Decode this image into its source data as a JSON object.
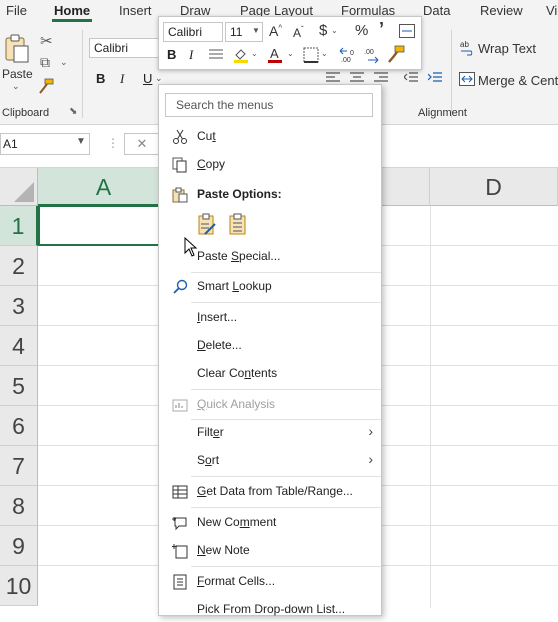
{
  "ribbon": {
    "tabs": [
      {
        "label": "File"
      },
      {
        "label": "Home"
      },
      {
        "label": "Insert"
      },
      {
        "label": "Draw"
      },
      {
        "label": "Page Layout"
      },
      {
        "label": "Formulas"
      },
      {
        "label": "Data"
      },
      {
        "label": "Review"
      },
      {
        "label": "View"
      }
    ],
    "active_tab": "Home",
    "paste_label": "Paste",
    "font_name": "Calibri",
    "clipboard_label": "Clipboard",
    "alignment_label": "Alignment",
    "wrap_text_label": "Wrap Text",
    "merge_label": "Merge & Center",
    "accent_color": "#217346"
  },
  "mini_toolbar": {
    "font": "Calibri",
    "size": "11",
    "currency_symbol": "$",
    "percent_symbol": "%",
    "comma_symbol": "’",
    "fill_color": "#FFD700",
    "font_color": "#C00000"
  },
  "formula_bar": {
    "name_box": "A1",
    "cancel_symbol": "✕"
  },
  "sheet": {
    "columns": [
      "A",
      "D"
    ],
    "rows": [
      "1",
      "2",
      "3",
      "4",
      "5",
      "6",
      "7",
      "8",
      "9",
      "10"
    ],
    "selected_cell": "A1"
  },
  "context_menu": {
    "search_placeholder": "Search the menus",
    "items": {
      "cut": {
        "pre": "Cu",
        "u": "t",
        "post": ""
      },
      "copy": {
        "pre": "",
        "u": "C",
        "post": "opy"
      },
      "paste_options": "Paste Options:",
      "paste_special": {
        "pre": "Paste ",
        "u": "S",
        "post": "pecial..."
      },
      "smart_lookup": {
        "pre": "Smart ",
        "u": "L",
        "post": "ookup"
      },
      "insert": {
        "pre": "",
        "u": "I",
        "post": "nsert..."
      },
      "delete": {
        "pre": "",
        "u": "D",
        "post": "elete..."
      },
      "clear_contents": {
        "pre": "Clear Co",
        "u": "n",
        "post": "tents"
      },
      "quick_analysis": {
        "pre": "",
        "u": "Q",
        "post": "uick Analysis"
      },
      "filter": {
        "pre": "Filt",
        "u": "e",
        "post": "r"
      },
      "sort": {
        "pre": "S",
        "u": "o",
        "post": "rt"
      },
      "get_data": {
        "pre": "",
        "u": "G",
        "post": "et Data from Table/Range..."
      },
      "new_comment": {
        "pre": "New Co",
        "u": "m",
        "post": "ment"
      },
      "new_note": {
        "pre": "",
        "u": "N",
        "post": "ew Note"
      },
      "format_cells": {
        "pre": "",
        "u": "F",
        "post": "ormat Cells..."
      },
      "pick_list": "Pick From Drop-down List..."
    }
  }
}
